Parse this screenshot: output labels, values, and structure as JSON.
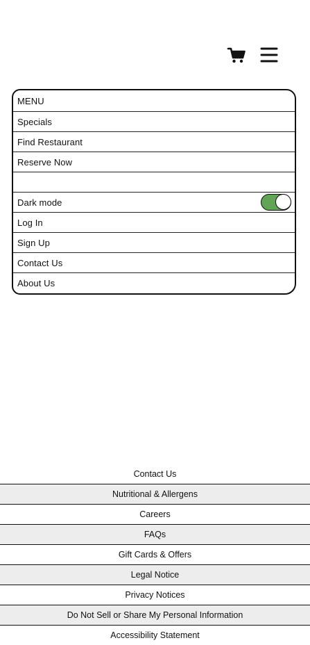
{
  "header": {
    "cart_icon": "shopping-cart-icon",
    "menu_icon": "hamburger-menu-icon"
  },
  "menu": {
    "title": "MENU",
    "items": [
      {
        "label": "Specials"
      },
      {
        "label": "Find Restaurant"
      },
      {
        "label": "Reserve Now"
      },
      {
        "label": ""
      },
      {
        "label": "Dark mode"
      },
      {
        "label": "Log In"
      },
      {
        "label": "Sign Up"
      },
      {
        "label": "Contact Us"
      },
      {
        "label": "About Us"
      }
    ],
    "dark_mode": {
      "on": true,
      "on_color": "#5fa553"
    }
  },
  "footer": {
    "links": [
      {
        "label": "Contact Us"
      },
      {
        "label": "Nutritional & Allergens"
      },
      {
        "label": "Careers"
      },
      {
        "label": "FAQs"
      },
      {
        "label": "Gift Cards & Offers"
      },
      {
        "label": "Legal Notice"
      },
      {
        "label": "Privacy Notices"
      },
      {
        "label": "Do Not Sell or Share My Personal Information"
      },
      {
        "label": "Accessibility Statement"
      }
    ],
    "shade_color": "#ededed"
  }
}
